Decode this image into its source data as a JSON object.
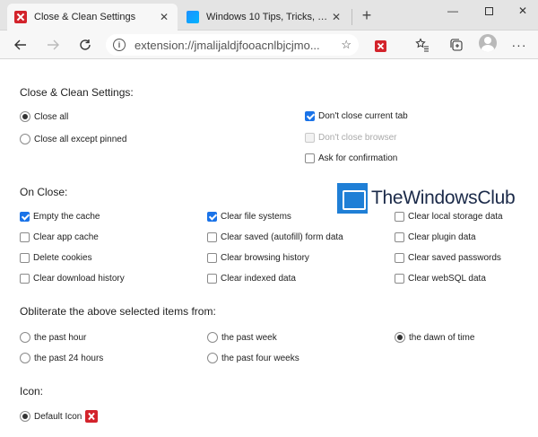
{
  "tabs": [
    {
      "title": "Close & Clean Settings",
      "favicon": "close-clean-x-icon"
    },
    {
      "title": "Windows 10 Tips, Tricks, Help, Su",
      "favicon": "windows-logo-icon"
    }
  ],
  "toolbar": {
    "url": "extension://jmalijaldjfooacnlbjcjmo..."
  },
  "page": {
    "title": "Close & Clean Settings:",
    "close_options": {
      "radio": [
        {
          "label": "Close all",
          "selected": true
        },
        {
          "label": "Close all except pinned",
          "selected": false
        }
      ],
      "checks": [
        {
          "label": "Don't close current tab",
          "checked": true,
          "disabled": false
        },
        {
          "label": "Don't close browser",
          "checked": false,
          "disabled": true
        },
        {
          "label": "Ask for confirmation",
          "checked": false,
          "disabled": false
        }
      ]
    },
    "on_close": {
      "heading": "On Close:",
      "items": [
        {
          "label": "Empty the cache",
          "checked": true
        },
        {
          "label": "Clear file systems",
          "checked": true
        },
        {
          "label": "Clear local storage data",
          "checked": false
        },
        {
          "label": "Clear app cache",
          "checked": false
        },
        {
          "label": "Clear saved (autofill) form data",
          "checked": false
        },
        {
          "label": "Clear plugin data",
          "checked": false
        },
        {
          "label": "Delete cookies",
          "checked": false
        },
        {
          "label": "Clear browsing history",
          "checked": false
        },
        {
          "label": "Clear saved passwords",
          "checked": false
        },
        {
          "label": "Clear download history",
          "checked": false
        },
        {
          "label": "Clear indexed data",
          "checked": false
        },
        {
          "label": "Clear webSQL data",
          "checked": false
        }
      ]
    },
    "obliterate": {
      "heading": "Obliterate the above selected items from:",
      "options": [
        {
          "label": "the past hour",
          "selected": false
        },
        {
          "label": "the past week",
          "selected": false
        },
        {
          "label": "the dawn of time",
          "selected": true
        },
        {
          "label": "the past 24 hours",
          "selected": false
        },
        {
          "label": "the past four weeks",
          "selected": false
        }
      ]
    },
    "icon": {
      "heading": "Icon:",
      "options": [
        {
          "label": "Default Icon",
          "selected": true
        }
      ]
    },
    "watermark": "TheWindowsClub"
  },
  "colors": {
    "accent": "#1a73e8",
    "brand_red": "#d3232b"
  }
}
